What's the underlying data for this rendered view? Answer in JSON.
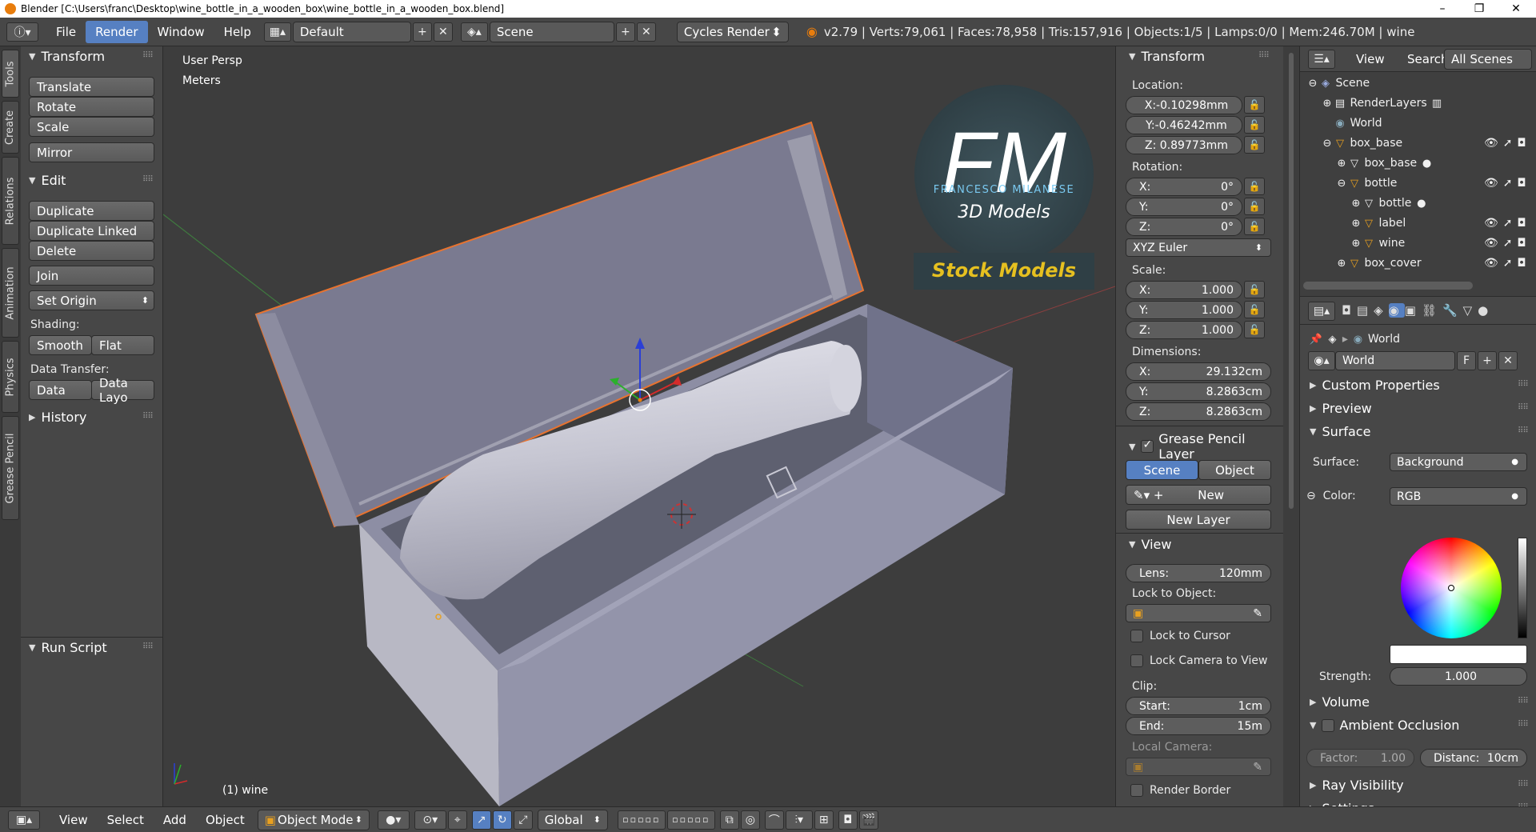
{
  "window": {
    "title": "Blender [C:\\Users\\franc\\Desktop\\wine_bottle_in_a_wooden_box\\wine_bottle_in_a_wooden_box.blend]",
    "min": "–",
    "max": "❐",
    "close": "✕"
  },
  "topbar": {
    "menus": [
      "File",
      "Render",
      "Window",
      "Help"
    ],
    "layout": "Default",
    "scene": "Scene",
    "engine": "Cycles Render",
    "stats": "v2.79 | Verts:79,061 | Faces:78,958 | Tris:157,916 | Objects:1/5 | Lamps:0/0 | Mem:246.70M | wine"
  },
  "tooltabs": [
    "Tools",
    "Create",
    "Relations",
    "Animation",
    "Physics",
    "Grease Pencil"
  ],
  "toolshelf": {
    "transform_header": "Transform",
    "translate": "Translate",
    "rotate": "Rotate",
    "scale": "Scale",
    "mirror": "Mirror",
    "edit_header": "Edit",
    "duplicate": "Duplicate",
    "duplicate_linked": "Duplicate Linked",
    "delete": "Delete",
    "join": "Join",
    "set_origin": "Set Origin",
    "shading_label": "Shading:",
    "smooth": "Smooth",
    "flat": "Flat",
    "data_transfer_label": "Data Transfer:",
    "data": "Data",
    "data_layo": "Data Layo",
    "history": "History",
    "run_script": "Run Script"
  },
  "viewport": {
    "view_name": "User Persp",
    "units": "Meters",
    "object_label": "(1) wine",
    "watermark": {
      "letters": "FM",
      "name": "FRANCESCO MILANESE",
      "sub": "3D Models",
      "banner": "Stock Models"
    }
  },
  "props": {
    "transform_header": "Transform",
    "location_label": "Location:",
    "loc_x": "X:-0.10298mm",
    "loc_y": "Y:-0.46242mm",
    "loc_z": "Z: 0.89773mm",
    "rotation_label": "Rotation:",
    "rot": [
      {
        "k": "X:",
        "v": "0°"
      },
      {
        "k": "Y:",
        "v": "0°"
      },
      {
        "k": "Z:",
        "v": "0°"
      }
    ],
    "rot_mode": "XYZ Euler",
    "scale_label": "Scale:",
    "scale": [
      {
        "k": "X:",
        "v": "1.000"
      },
      {
        "k": "Y:",
        "v": "1.000"
      },
      {
        "k": "Z:",
        "v": "1.000"
      }
    ],
    "dimensions_label": "Dimensions:",
    "dims": [
      {
        "k": "X:",
        "v": "29.132cm"
      },
      {
        "k": "Y:",
        "v": "8.2863cm"
      },
      {
        "k": "Z:",
        "v": "8.2863cm"
      }
    ],
    "gp_header": "Grease Pencil Layer",
    "gp_scene": "Scene",
    "gp_object": "Object",
    "gp_new": "New",
    "gp_new_layer": "New Layer",
    "view_header": "View",
    "lens": {
      "k": "Lens:",
      "v": "120mm"
    },
    "lock_obj_label": "Lock to Object:",
    "lock_cursor": "Lock to Cursor",
    "lock_camera": "Lock Camera to View",
    "clip_label": "Clip:",
    "clip_start": {
      "k": "Start:",
      "v": "1cm"
    },
    "clip_end": {
      "k": "End:",
      "v": "15m"
    },
    "local_camera": "Local Camera:",
    "render_border": "Render Border"
  },
  "outliner": {
    "view": "View",
    "search": "Search",
    "filter": "All Scenes",
    "items": [
      "Scene",
      "RenderLayers",
      "World",
      "box_base",
      "box_base",
      "bottle",
      "bottle",
      "label",
      "wine",
      "box_cover"
    ]
  },
  "world": {
    "breadcrumb": "World",
    "datablock": "World",
    "fake": "F",
    "custom_properties": "Custom Properties",
    "preview": "Preview",
    "surface": "Surface",
    "surface_label": "Surface:",
    "surface_value": "Background",
    "color_label": "Color:",
    "color_value": "RGB",
    "strength_label": "Strength:",
    "strength_value": "1.000",
    "volume": "Volume",
    "ambient_occlusion": "Ambient Occlusion",
    "factor": {
      "k": "Factor:",
      "v": "1.00"
    },
    "distance": {
      "k": "Distanc:",
      "v": "10cm"
    },
    "ray_visibility": "Ray Visibility",
    "settings": "Settings"
  },
  "bottombar": {
    "view": "View",
    "select": "Select",
    "add": "Add",
    "object": "Object",
    "mode": "Object Mode",
    "orientation": "Global"
  }
}
